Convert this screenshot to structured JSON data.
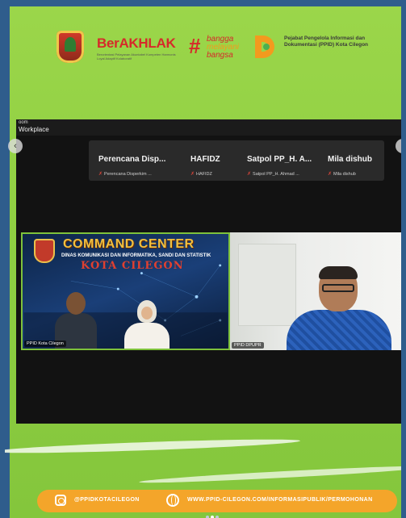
{
  "header": {
    "berakhlak_title": "BerAKHLAK",
    "berakhlak_tagline": "Berorientasi Pelayanan Akuntabel Kompeten Harmonis Loyal Adaptif Kolaboratif",
    "bangga_hash": "#",
    "bangga_words": [
      "bangga",
      "melayani",
      "bangsa"
    ],
    "ppid_text": "Pejabat Pengelola Informasi dan Dokumentasi (PPID) Kota Cilegon"
  },
  "zoom": {
    "app_label": "oom",
    "workspace_label": "Workplace",
    "participants": [
      {
        "name": "Perencana Disp...",
        "sub": "Perencana Disperkim ..."
      },
      {
        "name": "HAFIDZ",
        "sub": "HAFIDZ"
      },
      {
        "name": "Satpol PP_H. A...",
        "sub": "Satpol PP_H. Ahmad ..."
      },
      {
        "name": "Mila dishub",
        "sub": "Mila dishub"
      }
    ],
    "video_left": {
      "banner_title": "COMMAND CENTER",
      "banner_sub": "DINAS KOMUNIKASI DAN INFORMATIKA, SANDI DAN STATISTIK",
      "banner_city": "KOTA CILEGON",
      "label": "PPID Kota Cilegon"
    },
    "video_right": {
      "label": "PPID DPUPR"
    }
  },
  "footer": {
    "instagram": "@PPIDKOTACILEGON",
    "website": "WWW.PPID-CILEGON.COM/INFORMASIPUBLIK/PERMOHONAN"
  },
  "carousel": {
    "total": 3,
    "active": 2
  }
}
